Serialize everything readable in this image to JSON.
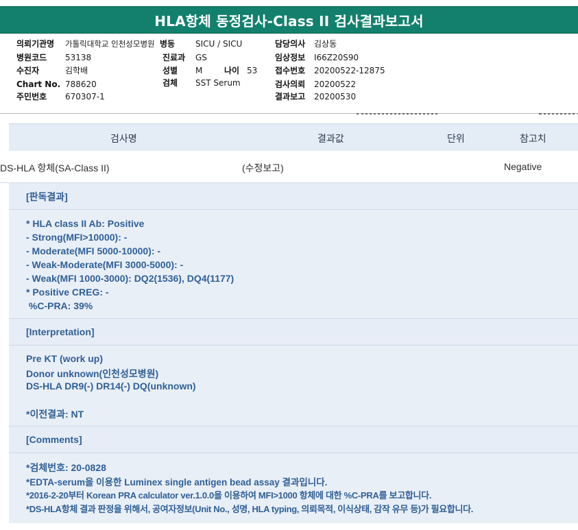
{
  "title": "HLA항체 동정검사-Class II 검사결과보고서",
  "header": {
    "col1": [
      {
        "label": "의뢰기관명",
        "value": "가톨릭대학교 인천성모병원"
      },
      {
        "label": "병원코드",
        "value": "53138"
      },
      {
        "label": "수진자",
        "value": "김학배"
      },
      {
        "label": "Chart No.",
        "value": "788620"
      },
      {
        "label": "주민번호",
        "value": "670307-1"
      }
    ],
    "col2": [
      {
        "label": "병동",
        "value": "SICU / SICU"
      },
      {
        "label": "진료과",
        "value": "GS"
      },
      {
        "label": "성별",
        "value": "M"
      },
      {
        "label": "검체",
        "value": "SST Serum"
      }
    ],
    "age": {
      "label": "나이",
      "value": "53"
    },
    "col3": [
      {
        "label": "담당의사",
        "value": "김상동"
      },
      {
        "label": "임상정보",
        "value": "I66Z20S90"
      },
      {
        "label": "접수번호",
        "value": "20200522-12875"
      },
      {
        "label": "검사의뢰",
        "value": "20200522"
      },
      {
        "label": "결과보고",
        "value": "20200530"
      }
    ]
  },
  "table": {
    "headers": [
      "검사명",
      "결과값",
      "단위",
      "참고치"
    ],
    "row": {
      "name": "DS-HLA 항체(SA-Class II)",
      "result": "(수정보고)",
      "unit": "",
      "reference": "Negative"
    }
  },
  "sections": {
    "judgment_header": "[판독결과]",
    "judgment_lines": [
      "* HLA class II Ab: Positive",
      "- Strong(MFI>10000): -",
      "- Moderate(MFI 5000-10000): -",
      "- Weak-Moderate(MFI 3000-5000): -",
      "- Weak(MFI 1000-3000): DQ2(1536), DQ4(1177)",
      "* Positive CREG: -",
      " %C-PRA: 39%"
    ],
    "interpretation_header": "[Interpretation]",
    "interpretation_lines": [
      "Pre KT (work up)",
      "Donor unknown(인천성모병원)",
      "DS-HLA DR9(-) DR14(-) DQ(unknown)",
      "",
      "*이전결과: NT"
    ],
    "comments_header": "[Comments]",
    "comments_lines": [
      "*검체번호: 20-0828",
      "*EDTA-serum을 이용한 Luminex single antigen bead assay 결과입니다.",
      "*2016-2-20부터 Korean PRA calculator ver.1.0.0을 이용하여 MFI>1000 항체에 대한 %C-PRA를 보고합니다.",
      "*DS-HLA항체 결과 판정을 위해서, 공여자정보(Unit No., 성명, HLA typing, 의뢰목적, 이식상태, 감작 유무 등)가 필요합니다."
    ]
  },
  "colors": {
    "title_bg": "#12806d",
    "section_text": "#2f5f96",
    "panel_bg": "#e9eff7"
  }
}
